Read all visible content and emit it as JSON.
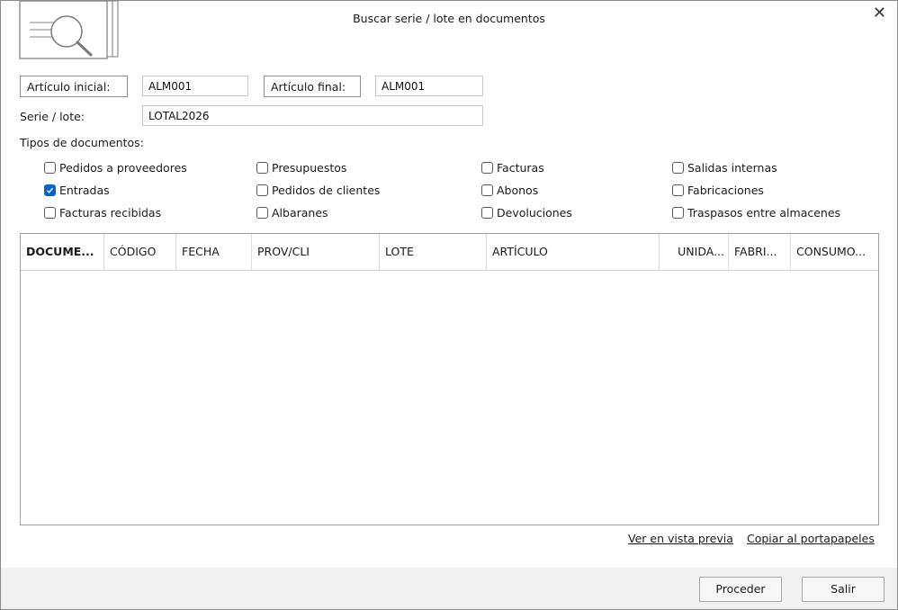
{
  "window": {
    "title": "Buscar serie / lote en documentos",
    "close_glyph": "✕"
  },
  "filters": {
    "articulo_inicial_label": "Artículo inicial:",
    "articulo_inicial_value": "ALM001",
    "articulo_final_label": "Artículo final:",
    "articulo_final_value": "ALM001",
    "serie_lote_label": "Serie / lote:",
    "serie_lote_value": "LOTAL2026"
  },
  "tipos": {
    "label": "Tipos de documentos:",
    "items": [
      {
        "label": "Pedidos a proveedores",
        "checked": false
      },
      {
        "label": "Entradas",
        "checked": true
      },
      {
        "label": "Facturas recibidas",
        "checked": false
      },
      {
        "label": "Presupuestos",
        "checked": false
      },
      {
        "label": "Pedidos de clientes",
        "checked": false
      },
      {
        "label": "Albaranes",
        "checked": false
      },
      {
        "label": "Facturas",
        "checked": false
      },
      {
        "label": "Abonos",
        "checked": false
      },
      {
        "label": "Devoluciones",
        "checked": false
      },
      {
        "label": "Salidas internas",
        "checked": false
      },
      {
        "label": "Fabricaciones",
        "checked": false
      },
      {
        "label": "Traspasos entre almacenes",
        "checked": false
      }
    ]
  },
  "grid": {
    "columns": [
      "DOCUME...",
      "CÓDIGO",
      "FECHA",
      "PROV/CLI",
      "LOTE",
      "ARTÍCULO",
      "UNIDA...",
      "FABRI...",
      "CONSUMO..."
    ],
    "rows": []
  },
  "links": {
    "preview": "Ver en vista previa",
    "copy": "Copiar al portapapeles"
  },
  "buttons": {
    "proceed": "Proceder",
    "exit": "Salir"
  },
  "colors": {
    "accent": "#0a63c9",
    "footer": "#f0f0f0"
  }
}
